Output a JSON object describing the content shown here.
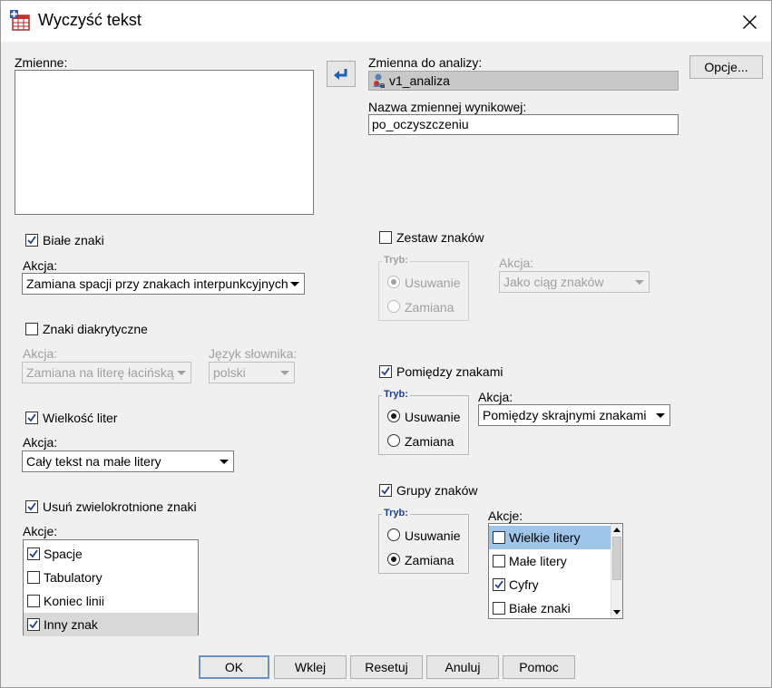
{
  "window": {
    "title": "Wyczyść tekst"
  },
  "left": {
    "variables_label": "Zmienne:",
    "white_chars": {
      "label": "Białe znaki",
      "checked": true,
      "action_label": "Akcja:",
      "action_value": "Zamiana spacji przy znakach interpunkcyjnych"
    },
    "diacritics": {
      "label": "Znaki diakrytyczne",
      "checked": false,
      "action_label": "Akcja:",
      "action_value": "Zamiana na literę łacińską",
      "dict_label": "Język słownika:",
      "dict_value": "polski"
    },
    "letter_case": {
      "label": "Wielkość liter",
      "checked": true,
      "action_label": "Akcja:",
      "action_value": "Cały tekst na małe litery"
    },
    "duplicates": {
      "label": "Usuń zwielokrotnione znaki",
      "checked": true,
      "actions_label": "Akcje:",
      "items": [
        {
          "label": "Spacje",
          "checked": true
        },
        {
          "label": "Tabulatory",
          "checked": false
        },
        {
          "label": "Koniec linii",
          "checked": false
        },
        {
          "label": "Inny znak",
          "checked": true
        }
      ]
    }
  },
  "right": {
    "analysis_var_label": "Zmienna do analizy:",
    "analysis_var_value": "v1_analiza",
    "output_var_label": "Nazwa zmiennej wynikowej:",
    "output_var_value": "po_oczyszczeniu",
    "options_button": "Opcje...",
    "charset": {
      "label": "Zestaw znaków",
      "checked": false,
      "mode_legend": "Tryb:",
      "mode_remove": "Usuwanie",
      "mode_replace": "Zamiana",
      "selected_mode": "remove",
      "action_label": "Akcja:",
      "action_value": "Jako ciąg znaków"
    },
    "between": {
      "label": "Pomiędzy znakami",
      "checked": true,
      "mode_legend": "Tryb:",
      "mode_remove": "Usuwanie",
      "mode_replace": "Zamiana",
      "selected_mode": "remove",
      "action_label": "Akcja:",
      "action_value": "Pomiędzy skrajnymi znakami"
    },
    "groups": {
      "label": "Grupy znaków",
      "checked": true,
      "mode_legend": "Tryb:",
      "mode_remove": "Usuwanie",
      "mode_replace": "Zamiana",
      "selected_mode": "replace",
      "actions_label": "Akcje:",
      "items": [
        {
          "label": "Wielkie litery",
          "checked": false
        },
        {
          "label": "Małe litery",
          "checked": false
        },
        {
          "label": "Cyfry",
          "checked": true
        },
        {
          "label": "Białe znaki",
          "checked": false
        }
      ]
    }
  },
  "buttons": {
    "ok": "OK",
    "paste": "Wklej",
    "reset": "Resetuj",
    "cancel": "Anuluj",
    "help": "Pomoc"
  },
  "colors": {
    "accent": "#1f5fb8",
    "selection_blue": "#9fc5e8",
    "selection_grey": "#d9d9d9"
  }
}
